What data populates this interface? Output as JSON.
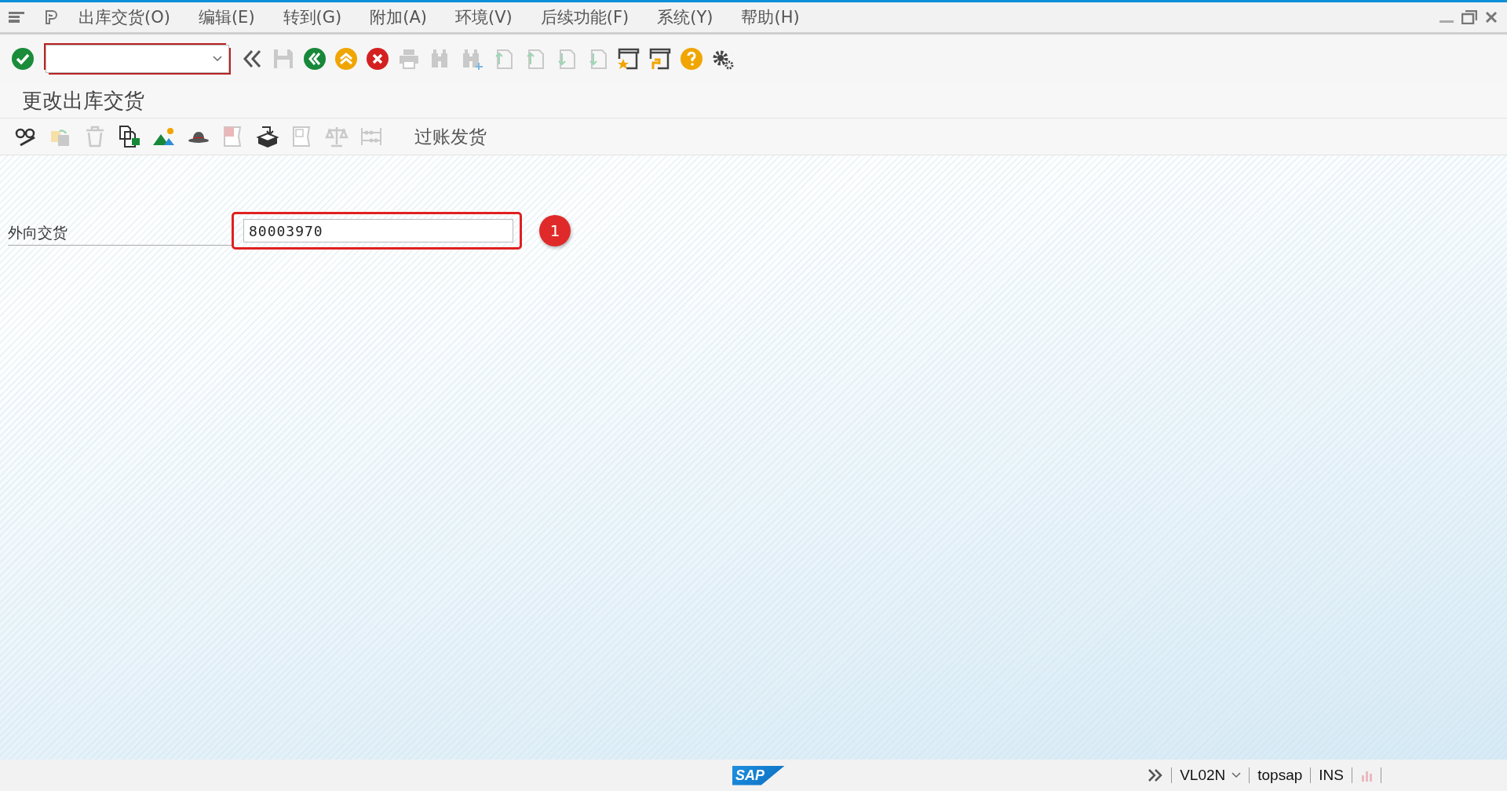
{
  "menu_bar": {
    "items": [
      "出库交货(O)",
      "编辑(E)",
      "转到(G)",
      "附加(A)",
      "环境(V)",
      "后续功能(F)",
      "系统(Y)",
      "帮助(H)"
    ]
  },
  "toolbar": {
    "items": [
      {
        "kind": "enter",
        "disabled": false
      },
      {
        "kind": "command",
        "disabled": false
      },
      {
        "kind": "chevrons",
        "disabled": false
      },
      {
        "kind": "save",
        "disabled": true
      },
      {
        "kind": "back",
        "disabled": false
      },
      {
        "kind": "exit",
        "disabled": false
      },
      {
        "kind": "cancel",
        "disabled": false
      },
      {
        "kind": "print",
        "disabled": true
      },
      {
        "kind": "find",
        "disabled": true
      },
      {
        "kind": "findnext",
        "disabled": true
      },
      {
        "kind": "pagefirst",
        "disabled": true
      },
      {
        "kind": "pageprev",
        "disabled": true
      },
      {
        "kind": "pagenext",
        "disabled": true
      },
      {
        "kind": "pagelast",
        "disabled": true
      },
      {
        "kind": "newsession",
        "disabled": false
      },
      {
        "kind": "shortcut",
        "disabled": false
      },
      {
        "kind": "help",
        "disabled": false
      },
      {
        "kind": "settings",
        "disabled": false
      }
    ]
  },
  "title": "更改出库交货",
  "app_toolbar": {
    "items": [
      {
        "kind": "glasses",
        "disabled": false
      },
      {
        "kind": "copy",
        "disabled": true
      },
      {
        "kind": "trash",
        "disabled": true
      },
      {
        "kind": "document",
        "disabled": false
      },
      {
        "kind": "mountains",
        "disabled": false
      },
      {
        "kind": "hat",
        "disabled": false
      },
      {
        "kind": "errorlog",
        "disabled": true
      },
      {
        "kind": "box",
        "disabled": false
      },
      {
        "kind": "question",
        "disabled": true
      },
      {
        "kind": "scale",
        "disabled": true
      },
      {
        "kind": "abacus",
        "disabled": true
      },
      {
        "kind": "text",
        "disabled": false,
        "label": "过账发货"
      }
    ]
  },
  "form": {
    "fields": [
      {
        "label": "外向交货",
        "value": "80003970",
        "highlighted": true,
        "marker": "1"
      }
    ]
  },
  "status_bar": {
    "logo": "SAP",
    "transaction": "VL02N",
    "system": "topsap",
    "mode": "INS"
  }
}
